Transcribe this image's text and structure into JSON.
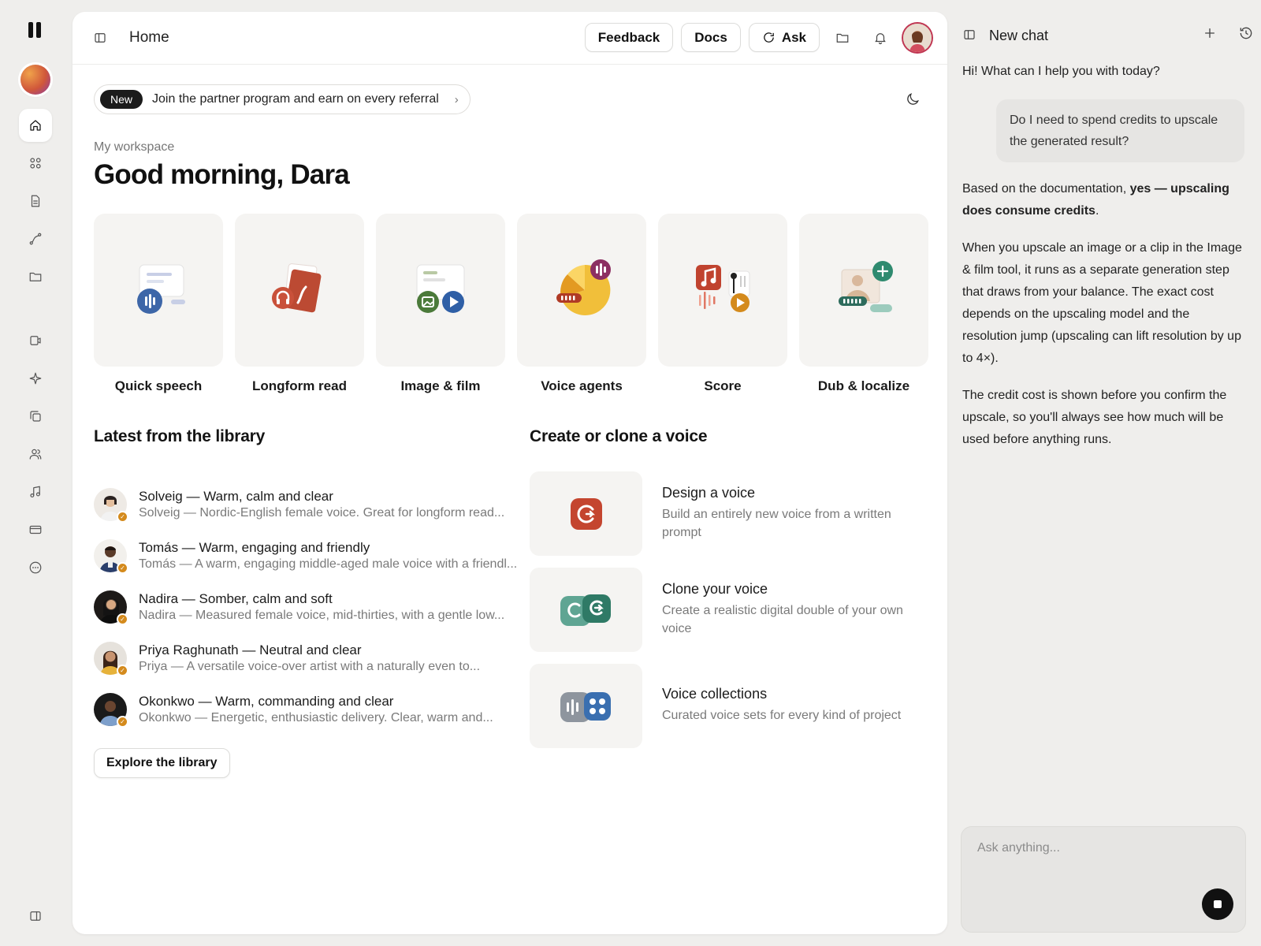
{
  "header": {
    "title": "Home",
    "feedback_label": "Feedback",
    "docs_label": "Docs",
    "ask_label": "Ask"
  },
  "banner": {
    "badge": "New",
    "text": "Join the partner program and earn on every referral"
  },
  "workspace_label": "My workspace",
  "greeting": "Good morning, Dara",
  "tiles": [
    {
      "label": "Quick speech"
    },
    {
      "label": "Longform read"
    },
    {
      "label": "Image & film"
    },
    {
      "label": "Voice agents"
    },
    {
      "label": "Score"
    },
    {
      "label": "Dub & localize"
    }
  ],
  "library": {
    "title": "Latest from the library",
    "items": [
      {
        "name": "Solveig — Warm, calm and clear",
        "desc": "Solveig — Nordic-English female voice. Great for longform read..."
      },
      {
        "name": "Tomás — Warm, engaging and friendly",
        "desc": "Tomás — A warm, engaging middle-aged male voice with a friendl..."
      },
      {
        "name": "Nadira — Somber, calm and soft",
        "desc": "Nadira — Measured female voice, mid-thirties, with a gentle low..."
      },
      {
        "name": "Priya Raghunath — Neutral and clear",
        "desc": "Priya — A versatile voice-over artist with a naturally even to..."
      },
      {
        "name": "Okonkwo — Warm, commanding and clear",
        "desc": "Okonkwo — Energetic, enthusiastic delivery. Clear, warm and..."
      }
    ],
    "explore_label": "Explore the library"
  },
  "voices": {
    "title": "Create or clone a voice",
    "items": [
      {
        "title": "Design a voice",
        "desc": "Build an entirely new voice from a written prompt"
      },
      {
        "title": "Clone your voice",
        "desc": "Create a realistic digital double of your own voice"
      },
      {
        "title": "Voice collections",
        "desc": "Curated voice sets for every kind of project"
      }
    ]
  },
  "chat": {
    "title": "New chat",
    "greeting": "Hi! What can I help you with today?",
    "user_message": "Do I need to spend credits to upscale the generated result?",
    "bot_p1_prefix": "Based on the documentation, ",
    "bot_p1_bold": "yes — upscaling does consume credits",
    "bot_p1_suffix": ".",
    "bot_p2": "When you upscale an image or a clip in the Image & film tool, it runs as a separate generation step that draws from your balance. The exact cost depends on the upscaling model and the resolution jump (upscaling can lift resolution by up to 4×).",
    "bot_p3": "The credit cost is shown before you confirm the upscale, so you'll always see how much will be used before anything runs.",
    "input_placeholder": "Ask anything..."
  },
  "colors": {
    "accent_dark": "#111111",
    "check_badge": "#d48a1c",
    "design_voice": "#c4452f",
    "clone_voice": "#2f8a6f",
    "collections": "#3a6fb0"
  }
}
